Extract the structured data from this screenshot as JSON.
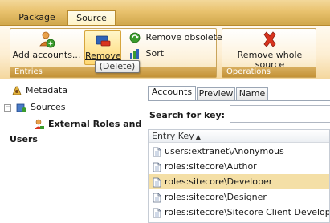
{
  "ribbon": {
    "tabs": [
      {
        "label": "Package"
      },
      {
        "label": "Source",
        "active": true
      }
    ],
    "groups": {
      "entries": {
        "caption": "Entries",
        "add_accounts": "Add accounts...",
        "remove": "Remove",
        "remove_obsolete": "Remove obsolete",
        "sort": "Sort"
      },
      "operations": {
        "caption": "Operations",
        "remove_whole_source": "Remove whole source"
      }
    },
    "tooltip": "(Delete)"
  },
  "tree": {
    "metadata": "Metadata",
    "sources": "Sources",
    "external_line1": "External Roles and",
    "external_line2": "Users"
  },
  "main": {
    "tabs": [
      {
        "label": "Accounts",
        "active": true
      },
      {
        "label": "Preview"
      },
      {
        "label": "Name"
      }
    ],
    "search_label": "Search for key:",
    "search_value": "",
    "grid": {
      "header": "Entry Key",
      "sort": "ascending",
      "rows": [
        {
          "key": "users:extranet\\Anonymous",
          "selected": false
        },
        {
          "key": "roles:sitecore\\Author",
          "selected": false
        },
        {
          "key": "roles:sitecore\\Developer",
          "selected": true
        },
        {
          "key": "roles:sitecore\\Designer",
          "selected": false
        },
        {
          "key": "roles:sitecore\\Sitecore Client Developing",
          "selected": false
        }
      ]
    }
  },
  "colors": {
    "ribbon_gold": "#c99d45",
    "selected_row": "#f4dfa6",
    "remove_icon_red": "#d9341f",
    "add_icon_green": "#3a9b2d"
  }
}
